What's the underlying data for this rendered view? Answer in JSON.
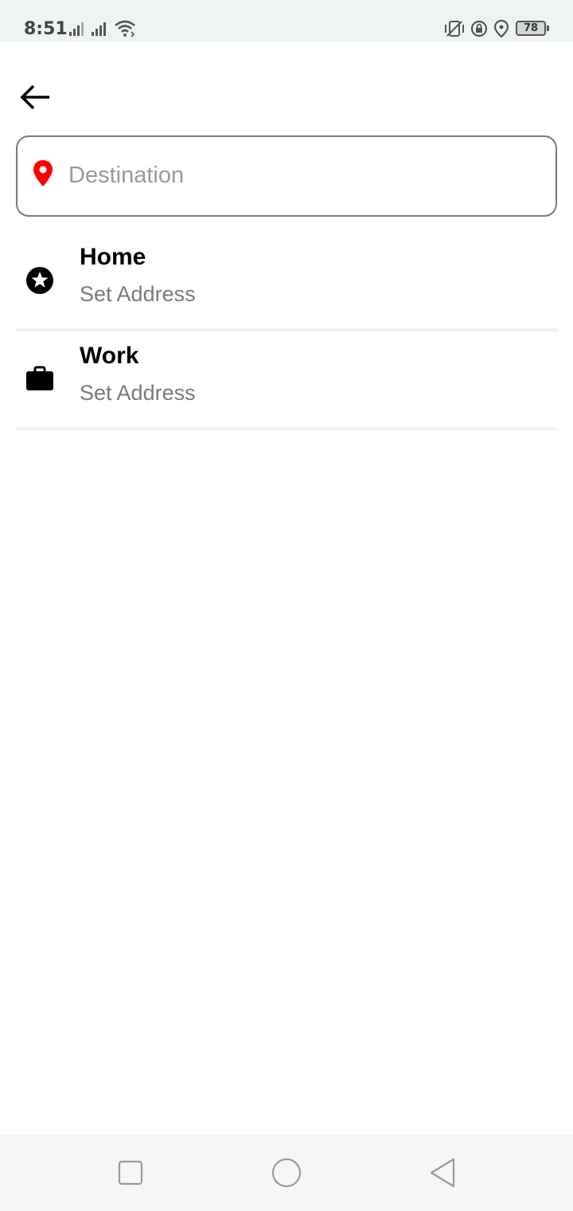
{
  "status_bar": {
    "time": "8:51",
    "battery_level": "78",
    "icons": [
      "signal-icon",
      "signal-icon",
      "wifi-icon",
      "vibrate-icon",
      "rotation-lock-icon",
      "location-icon",
      "battery-icon"
    ]
  },
  "header": {
    "back_icon": "arrow-left-icon"
  },
  "search": {
    "placeholder": "Destination",
    "value": "",
    "pin_color": "#ff0000"
  },
  "saved_places": [
    {
      "title": "Home",
      "subtitle": "Set Address",
      "icon": "star-circle-icon"
    },
    {
      "title": "Work",
      "subtitle": "Set Address",
      "icon": "briefcase-icon"
    }
  ],
  "nav_bar": {
    "buttons": [
      "recent-apps-icon",
      "home-icon",
      "back-icon"
    ]
  }
}
